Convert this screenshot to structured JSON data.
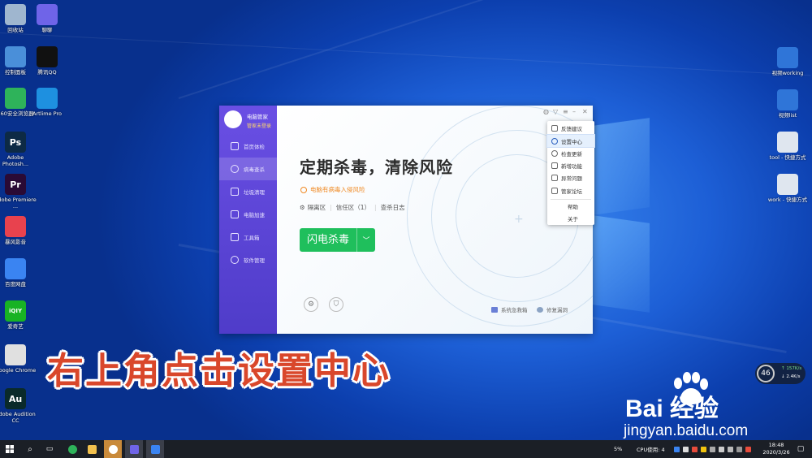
{
  "desktop_left": [
    {
      "label": "回收站",
      "icon": "recycle-bin-icon",
      "color": "#9fb6cf"
    },
    {
      "label": "聊聊",
      "icon": "chat-app-icon",
      "color": "#6f64e8"
    },
    {
      "label": "控制面板",
      "icon": "control-panel-icon",
      "color": "#4a8fd9"
    },
    {
      "label": "腾讯QQ",
      "icon": "qq-penguin-icon",
      "color": "#111111"
    },
    {
      "label": "360安全浏览器",
      "icon": "browser-360-icon",
      "color": "#2eb35a"
    },
    {
      "label": "Artlime Pro",
      "icon": "artlime-icon",
      "color": "#1e90e0"
    },
    {
      "label": "Adobe Photosh...",
      "icon": "photoshop-icon",
      "color": "#0d2a45",
      "glyph": "Ps"
    },
    {
      "label": "Adobe Premiere ...",
      "icon": "premiere-icon",
      "color": "#2a0a35",
      "glyph": "Pr"
    },
    {
      "label": "暴风影音",
      "icon": "media-player-icon",
      "color": "#e8424e"
    },
    {
      "label": "百度网盘",
      "icon": "cloud-drive-icon",
      "color": "#3a84f2"
    },
    {
      "label": "爱奇艺",
      "icon": "iqiyi-icon",
      "color": "#18b324",
      "glyph": "iQIY"
    },
    {
      "label": "Google Chrome",
      "icon": "chrome-icon",
      "color": "#e0e0e0"
    },
    {
      "label": "Adobe Audition CC",
      "icon": "audition-icon",
      "color": "#0a2a2a",
      "glyph": "Au"
    }
  ],
  "desktop_right": [
    {
      "label": "视频working",
      "icon": "folder-shortcut-icon"
    },
    {
      "label": "视频list",
      "icon": "folder-shortcut-icon"
    },
    {
      "label": "tool - 快捷方式",
      "icon": "file-shortcut-icon"
    },
    {
      "label": "work - 快捷方式",
      "icon": "file-shortcut-icon"
    }
  ],
  "app": {
    "profile_name": "电脑管家",
    "profile_status": "管家未登录",
    "nav": [
      {
        "label": "首页体检",
        "icon": "monitor-icon"
      },
      {
        "label": "病毒查杀",
        "icon": "virus-scan-icon",
        "active": true
      },
      {
        "label": "垃圾清理",
        "icon": "broom-icon"
      },
      {
        "label": "电脑加速",
        "icon": "rocket-icon"
      },
      {
        "label": "工具箱",
        "icon": "toolbox-icon"
      },
      {
        "label": "软件管理",
        "icon": "software-gear-icon"
      }
    ],
    "headline": "定期杀毒，清除风险",
    "warning": "电脑有病毒入侵风险",
    "links": [
      "隔离区",
      "信任区（1）",
      "查杀日志"
    ],
    "scan_button": "闪电杀毒",
    "bottom_links": [
      "系统急救箱",
      "修复漏洞"
    ],
    "accent": "#1fbf5c",
    "sidebar_color": "#5a45d6"
  },
  "menu": {
    "items": [
      {
        "label": "反馈建议",
        "icon": "feedback-icon"
      },
      {
        "label": "设置中心",
        "icon": "settings-gear-icon",
        "highlighted": true
      },
      {
        "label": "检查更新",
        "icon": "update-icon"
      },
      {
        "label": "新增功能",
        "icon": "star-icon"
      },
      {
        "label": "异常问题",
        "icon": "warning-icon"
      },
      {
        "label": "管家论坛",
        "icon": "forum-icon"
      },
      {
        "label": "帮助",
        "icon": ""
      },
      {
        "label": "关于",
        "icon": ""
      }
    ]
  },
  "caption": "右上角点击设置中心",
  "watermark": {
    "brand": "Bai 经验",
    "url": "jingyan.baidu.com"
  },
  "network": {
    "percent": "46",
    "up": "↑ 157K/s",
    "down": "↓ 2.4K/s"
  },
  "taskbar": {
    "cpu": "CPU使用: 4",
    "battery": "5%",
    "time": "18:48",
    "date": "2020/3/26"
  }
}
